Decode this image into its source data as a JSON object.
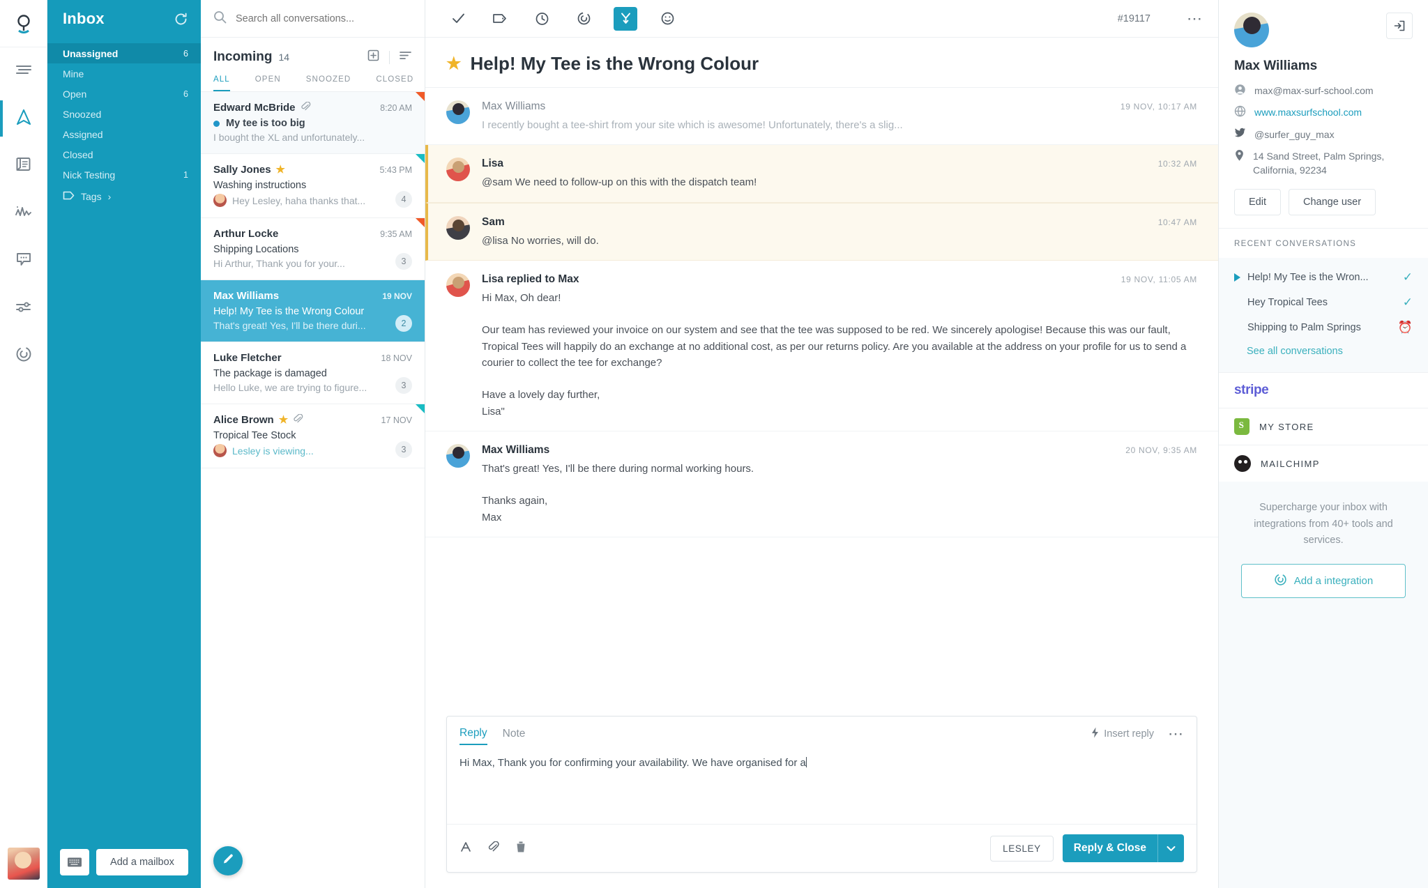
{
  "rail": {
    "logo_icon": "helpscout-logo-icon",
    "items": [
      {
        "name": "menu-icon",
        "active": false
      },
      {
        "name": "navigation-compass-icon",
        "active": true
      },
      {
        "name": "docs-book-icon",
        "active": false
      },
      {
        "name": "reports-chart-icon",
        "active": false
      },
      {
        "name": "beacon-chat-icon",
        "active": false
      },
      {
        "name": "settings-sliders-icon",
        "active": false
      },
      {
        "name": "target-circle-icon",
        "active": false
      }
    ],
    "avatar_name": "user-avatar"
  },
  "mailbox": {
    "title": "Inbox",
    "refresh_icon": "refresh-icon",
    "items": [
      {
        "label": "Unassigned",
        "count": "6",
        "active": true
      },
      {
        "label": "Mine",
        "count": "",
        "active": false
      },
      {
        "label": "Open",
        "count": "6",
        "active": false
      },
      {
        "label": "Snoozed",
        "count": "",
        "active": false
      },
      {
        "label": "Assigned",
        "count": "",
        "active": false
      },
      {
        "label": "Closed",
        "count": "",
        "active": false
      },
      {
        "label": "Nick Testing",
        "count": "1",
        "active": false
      }
    ],
    "tags_label": "Tags",
    "keyboard_icon": "keyboard-icon",
    "add_mailbox_label": "Add a mailbox"
  },
  "search": {
    "placeholder": "Search all conversations...",
    "icon": "search-icon"
  },
  "list": {
    "title": "Incoming",
    "count": "14",
    "new_folder_icon": "new-conversation-icon",
    "sort_icon": "sort-icon",
    "tabs": [
      {
        "label": "ALL",
        "active": true
      },
      {
        "label": "OPEN",
        "active": false
      },
      {
        "label": "SNOOZED",
        "active": false
      },
      {
        "label": "CLOSED",
        "active": false
      }
    ],
    "compose_icon": "compose-pencil-icon",
    "conversations": [
      {
        "name": "Edward McBride",
        "time": "8:20 AM",
        "subject": "My tee is too big",
        "preview": "I bought the XL and unfortunately...",
        "badge": "",
        "unread": true,
        "selected": false,
        "starred": false,
        "attachment": true,
        "corner": "red",
        "preview_avatar": false,
        "viewing": false
      },
      {
        "name": "Sally Jones",
        "time": "5:43 PM",
        "subject": "Washing instructions",
        "preview": "Hey Lesley, haha thanks that...",
        "badge": "4",
        "unread": false,
        "selected": false,
        "starred": true,
        "attachment": false,
        "corner": "teal",
        "preview_avatar": true,
        "viewing": false
      },
      {
        "name": "Arthur Locke",
        "time": "9:35 AM",
        "subject": "Shipping Locations",
        "preview": "Hi Arthur, Thank you for your...",
        "badge": "3",
        "unread": false,
        "selected": false,
        "starred": false,
        "attachment": false,
        "corner": "red",
        "preview_avatar": false,
        "viewing": false
      },
      {
        "name": "Max Williams",
        "time": "19 NOV",
        "subject": "Help! My Tee is the Wrong Colour",
        "preview": "That's great! Yes, I'll be there duri...",
        "badge": "2",
        "unread": false,
        "selected": true,
        "starred": false,
        "attachment": false,
        "corner": "",
        "preview_avatar": false,
        "viewing": false
      },
      {
        "name": "Luke Fletcher",
        "time": "18 NOV",
        "subject": "The package is damaged",
        "preview": "Hello Luke, we are trying to figure...",
        "badge": "3",
        "unread": false,
        "selected": false,
        "starred": false,
        "attachment": false,
        "corner": "",
        "preview_avatar": false,
        "viewing": false
      },
      {
        "name": "Alice Brown",
        "time": "17 NOV",
        "subject": "Tropical Tee Stock",
        "preview": "Lesley is viewing...",
        "badge": "3",
        "unread": false,
        "selected": false,
        "starred": true,
        "attachment": true,
        "corner": "teal",
        "preview_avatar": true,
        "viewing": true
      }
    ]
  },
  "thread": {
    "toolbar": [
      {
        "name": "close-check-icon",
        "active": false
      },
      {
        "name": "tag-icon",
        "active": false
      },
      {
        "name": "snooze-clock-icon",
        "active": false
      },
      {
        "name": "target-icon",
        "active": false
      },
      {
        "name": "merge-branch-icon",
        "active": true
      },
      {
        "name": "emoji-smiley-icon",
        "active": false
      }
    ],
    "conversation_id": "#19117",
    "more_icon": "more-options-icon",
    "star_icon": "star-icon",
    "title": "Help! My Tee is the Wrong Colour",
    "messages": [
      {
        "type": "collapsed",
        "avatar": "av-max",
        "author": "Max Williams",
        "time": "19 NOV, 10:17 AM",
        "text": "I recently bought a tee-shirt from your site which is awesome! Unfortunately, there's a slig..."
      },
      {
        "type": "note",
        "avatar": "av-lisa",
        "author": "Lisa",
        "time": "10:32 AM",
        "text": "@sam We need to follow-up on this with the dispatch team!"
      },
      {
        "type": "note",
        "avatar": "av-sam",
        "author": "Sam",
        "time": "10:47 AM",
        "text": "@lisa No worries, will do."
      },
      {
        "type": "full",
        "avatar": "av-lisa",
        "author": "Lisa replied to Max",
        "time": "19 NOV, 11:05 AM",
        "text": "Hi Max, Oh dear!\n\nOur team has reviewed your invoice on our system and see that the tee was supposed to be red. We sincerely apologise! Because this was our fault, Tropical Tees will happily do an exchange at no additional cost, as per our returns policy. Are you available at the address on your profile for us to send a courier to collect the tee for exchange?\n\nHave a lovely day further,\nLisa\""
      },
      {
        "type": "full",
        "avatar": "av-max",
        "author": "Max Williams",
        "time": "20 NOV, 9:35 AM",
        "text": "That's great! Yes, I'll be there during normal working hours.\n\nThanks again,\nMax"
      }
    ]
  },
  "composer": {
    "tabs": [
      {
        "label": "Reply",
        "active": true
      },
      {
        "label": "Note",
        "active": false
      }
    ],
    "insert_reply_label": "Insert reply",
    "insert_reply_icon": "lightning-bolt-icon",
    "more_icon": "more-options-icon",
    "body_text": "Hi Max, Thank you for confirming your availability. We have organised for a",
    "tools": [
      {
        "name": "text-format-icon",
        "glyph": "A"
      },
      {
        "name": "attachment-icon",
        "glyph": ""
      },
      {
        "name": "delete-trash-icon",
        "glyph": ""
      }
    ],
    "assignee_label": "LESLEY",
    "send_label": "Reply & Close",
    "send_dropdown_icon": "chevron-down-icon"
  },
  "customer": {
    "open_icon": "open-in-new-icon",
    "avatar_name": "customer-avatar",
    "name": "Max Williams",
    "fields": [
      {
        "icon": "person-icon",
        "value": "max@max-surf-school.com",
        "link": false
      },
      {
        "icon": "globe-icon",
        "value": "www.maxsurfschool.com",
        "link": true
      },
      {
        "icon": "twitter-icon",
        "value": "@surfer_guy_max",
        "link": false
      },
      {
        "icon": "location-pin-icon",
        "value": "14 Sand Street, Palm Springs, California, 92234",
        "link": false
      }
    ],
    "edit_label": "Edit",
    "change_user_label": "Change user",
    "recent_title": "RECENT CONVERSATIONS",
    "recent": [
      {
        "label": "Help! My Tee is the Wron...",
        "status": "check",
        "current": true
      },
      {
        "label": "Hey Tropical Tees",
        "status": "check",
        "current": false
      },
      {
        "label": "Shipping to Palm Springs",
        "status": "clock",
        "current": false
      }
    ],
    "see_all_label": "See all conversations",
    "integrations": [
      {
        "name": "stripe",
        "label": "stripe",
        "icon": "stripe-logo-icon"
      },
      {
        "name": "shopify",
        "label": "MY STORE",
        "icon": "shopify-logo-icon"
      },
      {
        "name": "mailchimp",
        "label": "MAILCHIMP",
        "icon": "mailchimp-logo-icon"
      }
    ],
    "promo_text": "Supercharge your inbox with integrations from 40+ tools and services.",
    "promo_btn_label": "Add a integration",
    "promo_btn_icon": "target-circle-icon"
  },
  "colors": {
    "accent": "#1b9dbd",
    "mailbox_bg": "#159bbb",
    "selected_row": "#46b3d4",
    "note_bg": "#fdf9ee",
    "note_border": "#e8b94a"
  }
}
